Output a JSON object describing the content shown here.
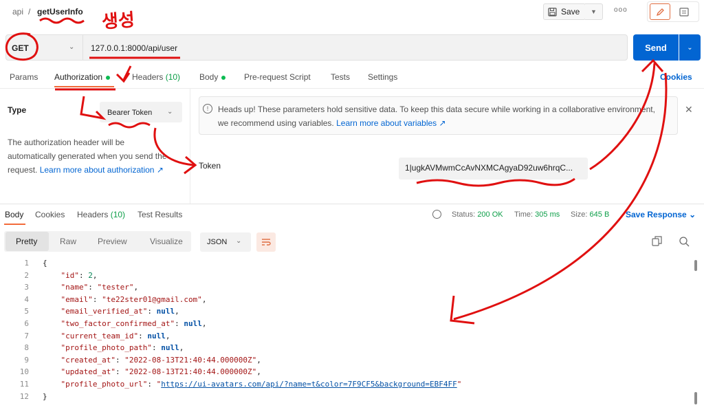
{
  "breadcrumb": {
    "collection": "api",
    "separator": "/",
    "request_name": "getUserInfo"
  },
  "toolbar": {
    "save_label": "Save",
    "more_label": "ooo"
  },
  "request": {
    "method": "GET",
    "url": "127.0.0.1:8000/api/user",
    "send_label": "Send"
  },
  "request_tabs": [
    {
      "label": "Params"
    },
    {
      "label": "Authorization",
      "active": true,
      "dot": true
    },
    {
      "label": "Headers",
      "count": "(10)"
    },
    {
      "label": "Body",
      "dot": true
    },
    {
      "label": "Pre-request Script"
    },
    {
      "label": "Tests"
    },
    {
      "label": "Settings"
    }
  ],
  "cookies_link": "Cookies",
  "auth": {
    "type_label": "Type",
    "type_value": "Bearer Token",
    "desc_line1": "The authorization header will be",
    "desc_line2": "automatically generated when you send the",
    "desc_line3_prefix": "request.",
    "desc_link": "Learn more about authorization ↗",
    "heads_up_line1": "Heads up! These parameters hold sensitive data. To keep this data secure while working in a collaborative environment,",
    "heads_up_line2_prefix": "we recommend using variables.",
    "heads_up_link": "Learn more about variables ↗",
    "token_label": "Token",
    "token_value": "1|ugkAVMwmCcAvNXMCAgyaD92uw6hrqC..."
  },
  "response": {
    "tabs": [
      {
        "label": "Body",
        "active": true
      },
      {
        "label": "Cookies"
      },
      {
        "label": "Headers",
        "count": "(10)"
      },
      {
        "label": "Test Results"
      }
    ],
    "status_label": "Status:",
    "status_value": "200 OK",
    "time_label": "Time:",
    "time_value": "305 ms",
    "size_label": "Size:",
    "size_value": "645 B",
    "save_response": "Save Response",
    "format_tabs": [
      "Pretty",
      "Raw",
      "Preview",
      "Visualize"
    ],
    "format": "JSON"
  },
  "body_lines": [
    {
      "n": "1",
      "t": "{"
    },
    {
      "n": "2",
      "key": "\"id\"",
      "num": "2"
    },
    {
      "n": "3",
      "key": "\"name\"",
      "str": "\"tester\""
    },
    {
      "n": "4",
      "key": "\"email\"",
      "str": "\"te22ster01@gmail.com\""
    },
    {
      "n": "5",
      "key": "\"email_verified_at\"",
      "nul": "null"
    },
    {
      "n": "6",
      "key": "\"two_factor_confirmed_at\"",
      "nul": "null"
    },
    {
      "n": "7",
      "key": "\"current_team_id\"",
      "nul": "null"
    },
    {
      "n": "8",
      "key": "\"profile_photo_path\"",
      "nul": "null"
    },
    {
      "n": "9",
      "key": "\"created_at\"",
      "str": "\"2022-08-13T21:40:44.000000Z\""
    },
    {
      "n": "10",
      "key": "\"updated_at\"",
      "str": "\"2022-08-13T21:40:44.000000Z\""
    },
    {
      "n": "11",
      "key": "\"profile_photo_url\"",
      "url": "https://ui-avatars.com/api/?name=t&color=7F9CF5&background=EBF4FF",
      "last": true
    },
    {
      "n": "12",
      "t": "}"
    }
  ],
  "annotation": {
    "handwritten": "생성",
    "color": "#e01010"
  },
  "colors": {
    "accent": "#f26b3a",
    "send": "#0265d2",
    "ok": "#0cbb52",
    "annotation": "#e01010"
  }
}
